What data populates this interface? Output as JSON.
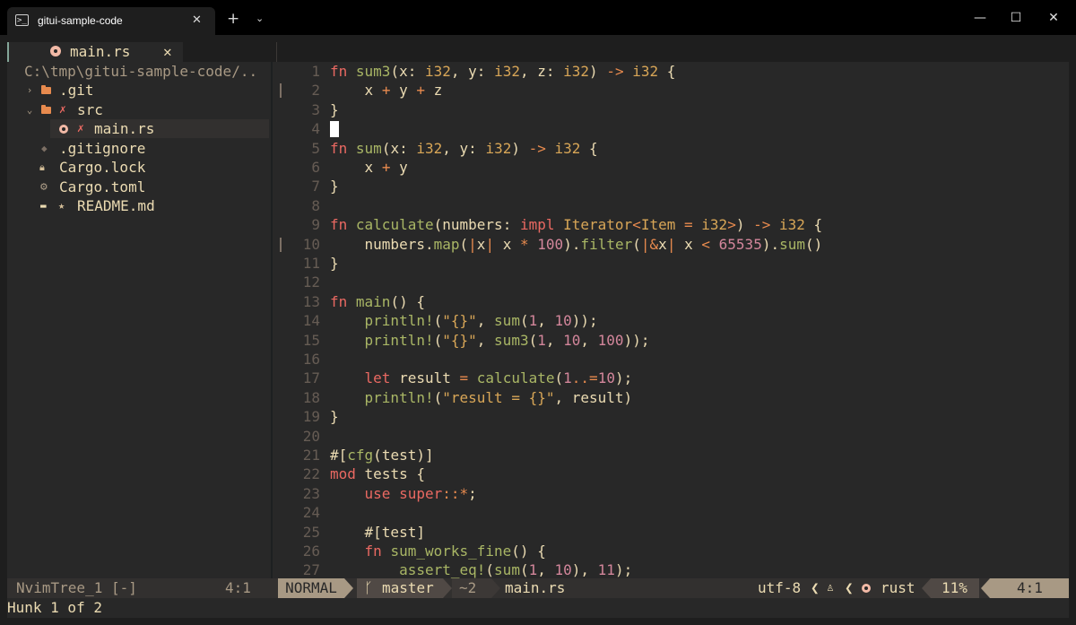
{
  "window": {
    "tab_title": "gitui-sample-code",
    "new_tab_glyph": "+",
    "dropdown_glyph": "⌄",
    "close_glyph": "✕",
    "minimize_glyph": "—",
    "maximize_glyph": "☐",
    "window_close_glyph": "✕",
    "terminal_icon_text": ">_"
  },
  "buffer_tab": {
    "label": "main.rs",
    "close": "✕"
  },
  "tree": {
    "cwd": "C:\\tmp\\gitui-sample-code/..",
    "items": [
      {
        "name": ".git",
        "arrow": "›",
        "icon": "folder-icon"
      },
      {
        "name": "src",
        "arrow": "⌄",
        "icon": "folder-open-icon",
        "git": "✗"
      },
      {
        "name": "main.rs",
        "icon": "rust-file-icon",
        "git": "✗"
      },
      {
        "name": ".gitignore",
        "icon": "git-icon",
        "glyph": "◆"
      },
      {
        "name": "Cargo.lock",
        "icon": "lock-icon",
        "glyph": "🔒︎"
      },
      {
        "name": "Cargo.toml",
        "icon": "gear-icon",
        "glyph": "⚙"
      },
      {
        "name": "README.md",
        "icon": "markdown-icon",
        "glyph": "▬",
        "star": "★"
      }
    ]
  },
  "code": {
    "lines": [
      {
        "n": "1",
        "text": "fn sum3(x: i32, y: i32, z: i32) -> i32 {"
      },
      {
        "n": "2",
        "text": "    x + y + z"
      },
      {
        "n": "3",
        "text": "}"
      },
      {
        "n": "4",
        "text": ""
      },
      {
        "n": "5",
        "text": "fn sum(x: i32, y: i32) -> i32 {"
      },
      {
        "n": "6",
        "text": "    x + y"
      },
      {
        "n": "7",
        "text": "}"
      },
      {
        "n": "8",
        "text": ""
      },
      {
        "n": "9",
        "text": "fn calculate(numbers: impl Iterator<Item = i32>) -> i32 {"
      },
      {
        "n": "10",
        "text": "    numbers.map(|x| x * 100).filter(|&x| x < 65535).sum()"
      },
      {
        "n": "11",
        "text": "}"
      },
      {
        "n": "12",
        "text": ""
      },
      {
        "n": "13",
        "text": "fn main() {"
      },
      {
        "n": "14",
        "text": "    println!(\"{}\", sum(1, 10));"
      },
      {
        "n": "15",
        "text": "    println!(\"{}\", sum3(1, 10, 100));"
      },
      {
        "n": "16",
        "text": ""
      },
      {
        "n": "17",
        "text": "    let result = calculate(1..=10);"
      },
      {
        "n": "18",
        "text": "    println!(\"result = {}\", result)"
      },
      {
        "n": "19",
        "text": "}"
      },
      {
        "n": "20",
        "text": ""
      },
      {
        "n": "21",
        "text": "#[cfg(test)]"
      },
      {
        "n": "22",
        "text": "mod tests {"
      },
      {
        "n": "23",
        "text": "    use super::*;"
      },
      {
        "n": "24",
        "text": ""
      },
      {
        "n": "25",
        "text": "    #[test]"
      },
      {
        "n": "26",
        "text": "    fn sum_works_fine() {"
      },
      {
        "n": "27",
        "text": "        assert_eq!(sum(1, 10), 11);"
      }
    ],
    "cursor_line": 4,
    "changed_lines": [
      2,
      10
    ]
  },
  "status": {
    "tree_name": "NvimTree_1 [-]",
    "tree_pos": "4:1",
    "mode": "NORMAL",
    "branch_glyph": "ᚴ",
    "branch": "master",
    "diff": "~2",
    "filename": "main.rs",
    "encoding": "utf-8",
    "format_glyph": "♙",
    "filetype": "rust",
    "percent": "11%",
    "position": "4:1"
  },
  "cmdline": {
    "text": "Hunk 1 of 2"
  },
  "colors": {
    "background": "#282828",
    "foreground": "#ebdbb2",
    "keyword": "#ea6962",
    "function": "#a9b665",
    "type": "#d8a657",
    "number": "#d3869b",
    "operator": "#e78a4e",
    "line_number": "#665c54"
  }
}
